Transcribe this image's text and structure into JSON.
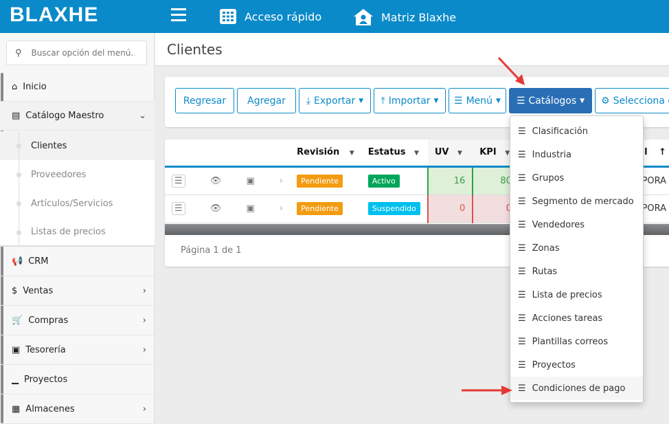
{
  "header": {
    "logo": "BLAXHE",
    "quick_access": "Acceso rápido",
    "branch": "Matriz Blaxhe"
  },
  "sidebar": {
    "search_placeholder": "Buscar opción del menú...",
    "items": [
      {
        "label": "Inicio",
        "icon": "home-icon"
      },
      {
        "label": "Catálogo Maestro",
        "icon": "clipboard-icon"
      }
    ],
    "subitems": [
      "Clientes",
      "Proveedores",
      "Artículos/Servicios",
      "Listas de precios"
    ],
    "more": [
      {
        "label": "CRM",
        "icon": "megaphone-icon"
      },
      {
        "label": "Ventas",
        "icon": "dollar-icon"
      },
      {
        "label": "Compras",
        "icon": "cart-icon"
      },
      {
        "label": "Tesorería",
        "icon": "money-icon"
      },
      {
        "label": "Proyectos",
        "icon": "chart-icon"
      },
      {
        "label": "Almacenes",
        "icon": "warehouse-icon"
      }
    ]
  },
  "page": {
    "title": "Clientes"
  },
  "toolbar": {
    "back": "Regresar",
    "add": "Agregar",
    "export": "Exportar",
    "import": "Importar",
    "menu": "Menú",
    "catalogs": "Catálogos",
    "select": "Selecciona co"
  },
  "table": {
    "headers": {
      "revision": "Revisión",
      "status": "Estatus",
      "uv": "UV",
      "kpi": "KPI",
      "extra": "l"
    },
    "rows": [
      {
        "revision": "Pendiente",
        "status": "Activo",
        "uv": "16",
        "kpi": "80",
        "extra": "RPORA"
      },
      {
        "revision": "Pendiente",
        "status": "Suspendido",
        "uv": "0",
        "kpi": "0",
        "extra": "RPORA"
      }
    ],
    "footer": "Página 1 de 1"
  },
  "colors": {
    "primary": "#0a8ac9",
    "pending": "#f39c12",
    "active": "#00a65a",
    "suspended": "#00c0ef"
  },
  "catalog_menu": [
    "Clasificación",
    "Industria",
    "Grupos",
    "Segmento de mercado",
    "Vendedores",
    "Zonas",
    "Rutas",
    "Lista de precios",
    "Acciones tareas",
    "Plantillas correos",
    "Proyectos",
    "Condiciones de pago"
  ]
}
